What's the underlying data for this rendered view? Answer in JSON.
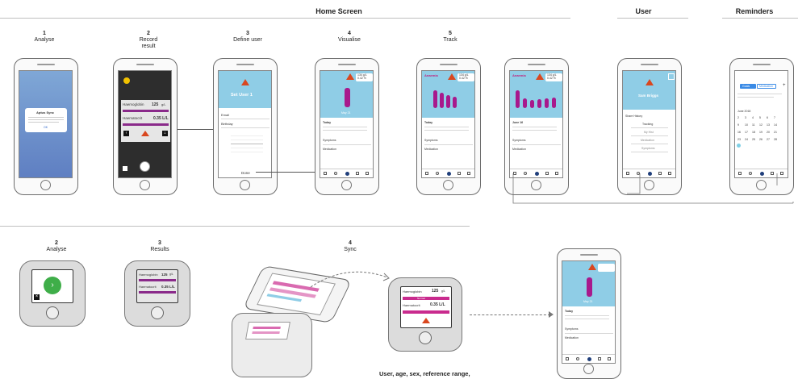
{
  "sections": {
    "home_screen": "Home Screen",
    "user": "User",
    "reminders": "Reminders"
  },
  "top_steps": [
    {
      "num": "1",
      "label": "Analyse"
    },
    {
      "num": "2",
      "label": "Record\nresult"
    },
    {
      "num": "3",
      "label": "Define user"
    },
    {
      "num": "4",
      "label": "Visualise"
    },
    {
      "num": "5",
      "label": "Track"
    }
  ],
  "bottom_steps": [
    {
      "num": "2",
      "label": "Analyse"
    },
    {
      "num": "3",
      "label": "Results"
    },
    {
      "num": "4",
      "label": "Sync"
    }
  ],
  "phone1": {
    "dialog_title": "Aptus Sync",
    "ok": "OK"
  },
  "phone2": {
    "hb_label": "Haemoglobin",
    "hb_value": "125",
    "hb_unit": "g/L",
    "ht_label": "Haematocrit",
    "ht_value": "0.35 L/L"
  },
  "phone3": {
    "title": "Set User 1",
    "email_label": "Email",
    "birthday_label": "Birthday",
    "done": "Done"
  },
  "phone4": {
    "badge1": "134 g/L",
    "badge2": "0.42 %",
    "date": "May 21",
    "today": "Today",
    "symptoms": "Symptoms",
    "medication": "Medication"
  },
  "phone5": {
    "title": "Anaemia",
    "badge1": "134 g/L",
    "badge2": "0.42 %",
    "today": "Today",
    "symptoms": "Symptoms",
    "medication": "Medication"
  },
  "phone6": {
    "title": "Anaemia",
    "badge1": "134 g/L",
    "badge2": "0.42 %",
    "date": "June 16",
    "symptoms": "Symptoms",
    "medication": "Medication"
  },
  "phone7": {
    "name": "Sam Briggs",
    "share_label": "Share History",
    "items": [
      "Tracking",
      "My Hist",
      "Medication",
      "Symptoms"
    ]
  },
  "phone8": {
    "month": "June 2018",
    "tab1": "Goals",
    "tab2": "Medication",
    "weeks": [
      [
        "2",
        "3",
        "4",
        "5",
        "6",
        "7"
      ],
      [
        "9",
        "10",
        "11",
        "12",
        "13",
        "14"
      ],
      [
        "16",
        "17",
        "18",
        "19",
        "20",
        "21"
      ],
      [
        "23",
        "24",
        "25",
        "26",
        "27",
        "28"
      ]
    ]
  },
  "device2": {
    "hb_label": "Haemoglobin",
    "hb_value": "125",
    "hb_unit": "g/L",
    "ht_label": "Haematocrit",
    "ht_value": "0.35 L/L"
  },
  "device_sync": {
    "hb_label": "Haemoglobin",
    "hb_value": "125",
    "hb_unit": "g/L",
    "ht_label": "Haematocrit",
    "ht_value": "0.35 L/L",
    "normal": "Normal"
  },
  "phone9": {
    "date": "May 21",
    "today": "Today",
    "symptoms": "Symptoms",
    "medication": "Medication"
  },
  "sync_caption": "User, age, sex, reference range,"
}
